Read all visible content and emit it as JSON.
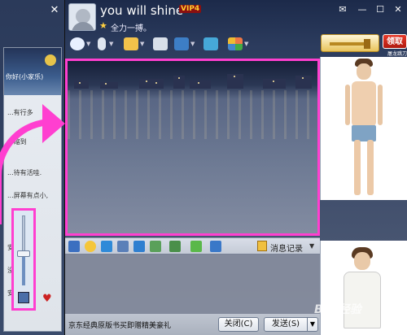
{
  "contact": {
    "name": "you will shine",
    "vip_badge": "VIP4",
    "signature": "全力一搏。"
  },
  "window_controls": [
    "mail-icon",
    "minimize-icon",
    "maximize-icon",
    "close-icon"
  ],
  "promo": {
    "claim_button": "领取",
    "caption": "屠龙跳刀"
  },
  "toolbar_icons": [
    "video-call-icon",
    "voice-call-icon",
    "send-file-icon",
    "create-group-icon",
    "remote-desktop-icon",
    "share-screen-icon",
    "apps-icon"
  ],
  "input_toolbar": {
    "icons": [
      "font-icon",
      "emoji-icon",
      "shake-icon",
      "screen-capture-icon",
      "voice-message-icon",
      "scribble-icon",
      "send-image-icon",
      "music-icon",
      "screenshot-icon"
    ],
    "history_label": "消息记录"
  },
  "bottom_bar": {
    "ad_text": "京东经典原版书买即赠精美豪礼",
    "close_button": "关闭(C)",
    "send_button": "发送(S)"
  },
  "background_window": {
    "header_text": "你好(小家乐)",
    "snippets": [
      "...有行多",
      "...缩到",
      "...待有活哇.",
      "...屏幕有点小,",
      "安",
      "没",
      "安"
    ]
  },
  "watermark": "Bai 经验",
  "colors": {
    "highlight": "#ff3fd0",
    "claim_button": "#c8241a"
  }
}
